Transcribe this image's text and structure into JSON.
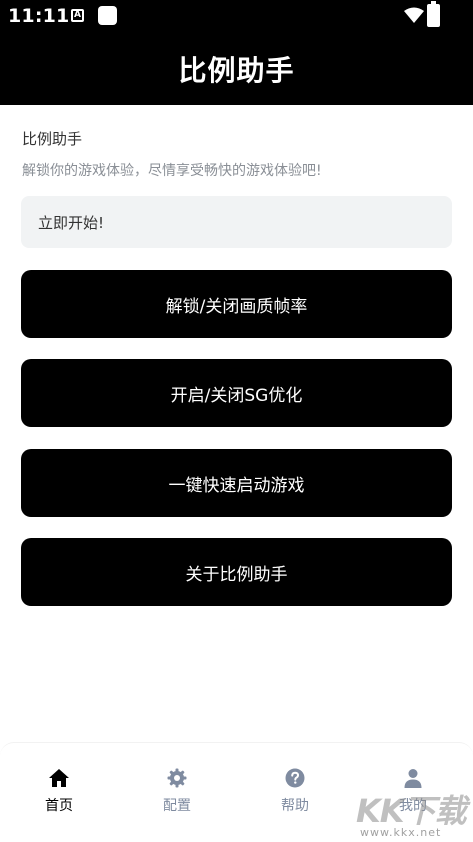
{
  "status_bar": {
    "time": "11:11",
    "a_glyph": "A"
  },
  "app_bar": {
    "title": "比例助手"
  },
  "intro": {
    "title": "比例助手",
    "subtitle": "解锁你的游戏体验，尽情享受畅快的游戏体验吧!"
  },
  "start_box": {
    "label": "立即开始!"
  },
  "actions": [
    {
      "label": "解锁/关闭画质帧率"
    },
    {
      "label": "开启/关闭SG优化"
    },
    {
      "label": "一键快速启动游戏"
    },
    {
      "label": "关于比例助手"
    }
  ],
  "tabs": [
    {
      "label": "首页",
      "icon": "home-icon",
      "active": true
    },
    {
      "label": "配置",
      "icon": "gear-icon",
      "active": false
    },
    {
      "label": "帮助",
      "icon": "help-icon",
      "active": false
    },
    {
      "label": "我的",
      "icon": "user-icon",
      "active": false
    }
  ],
  "watermark": {
    "big": "KK下载",
    "small": "www.kkx.net"
  },
  "colors": {
    "primary": "#000000",
    "inactive_tab": "#7f8ba0",
    "input_bg": "#f1f3f4",
    "subtitle": "#8a8f96"
  }
}
